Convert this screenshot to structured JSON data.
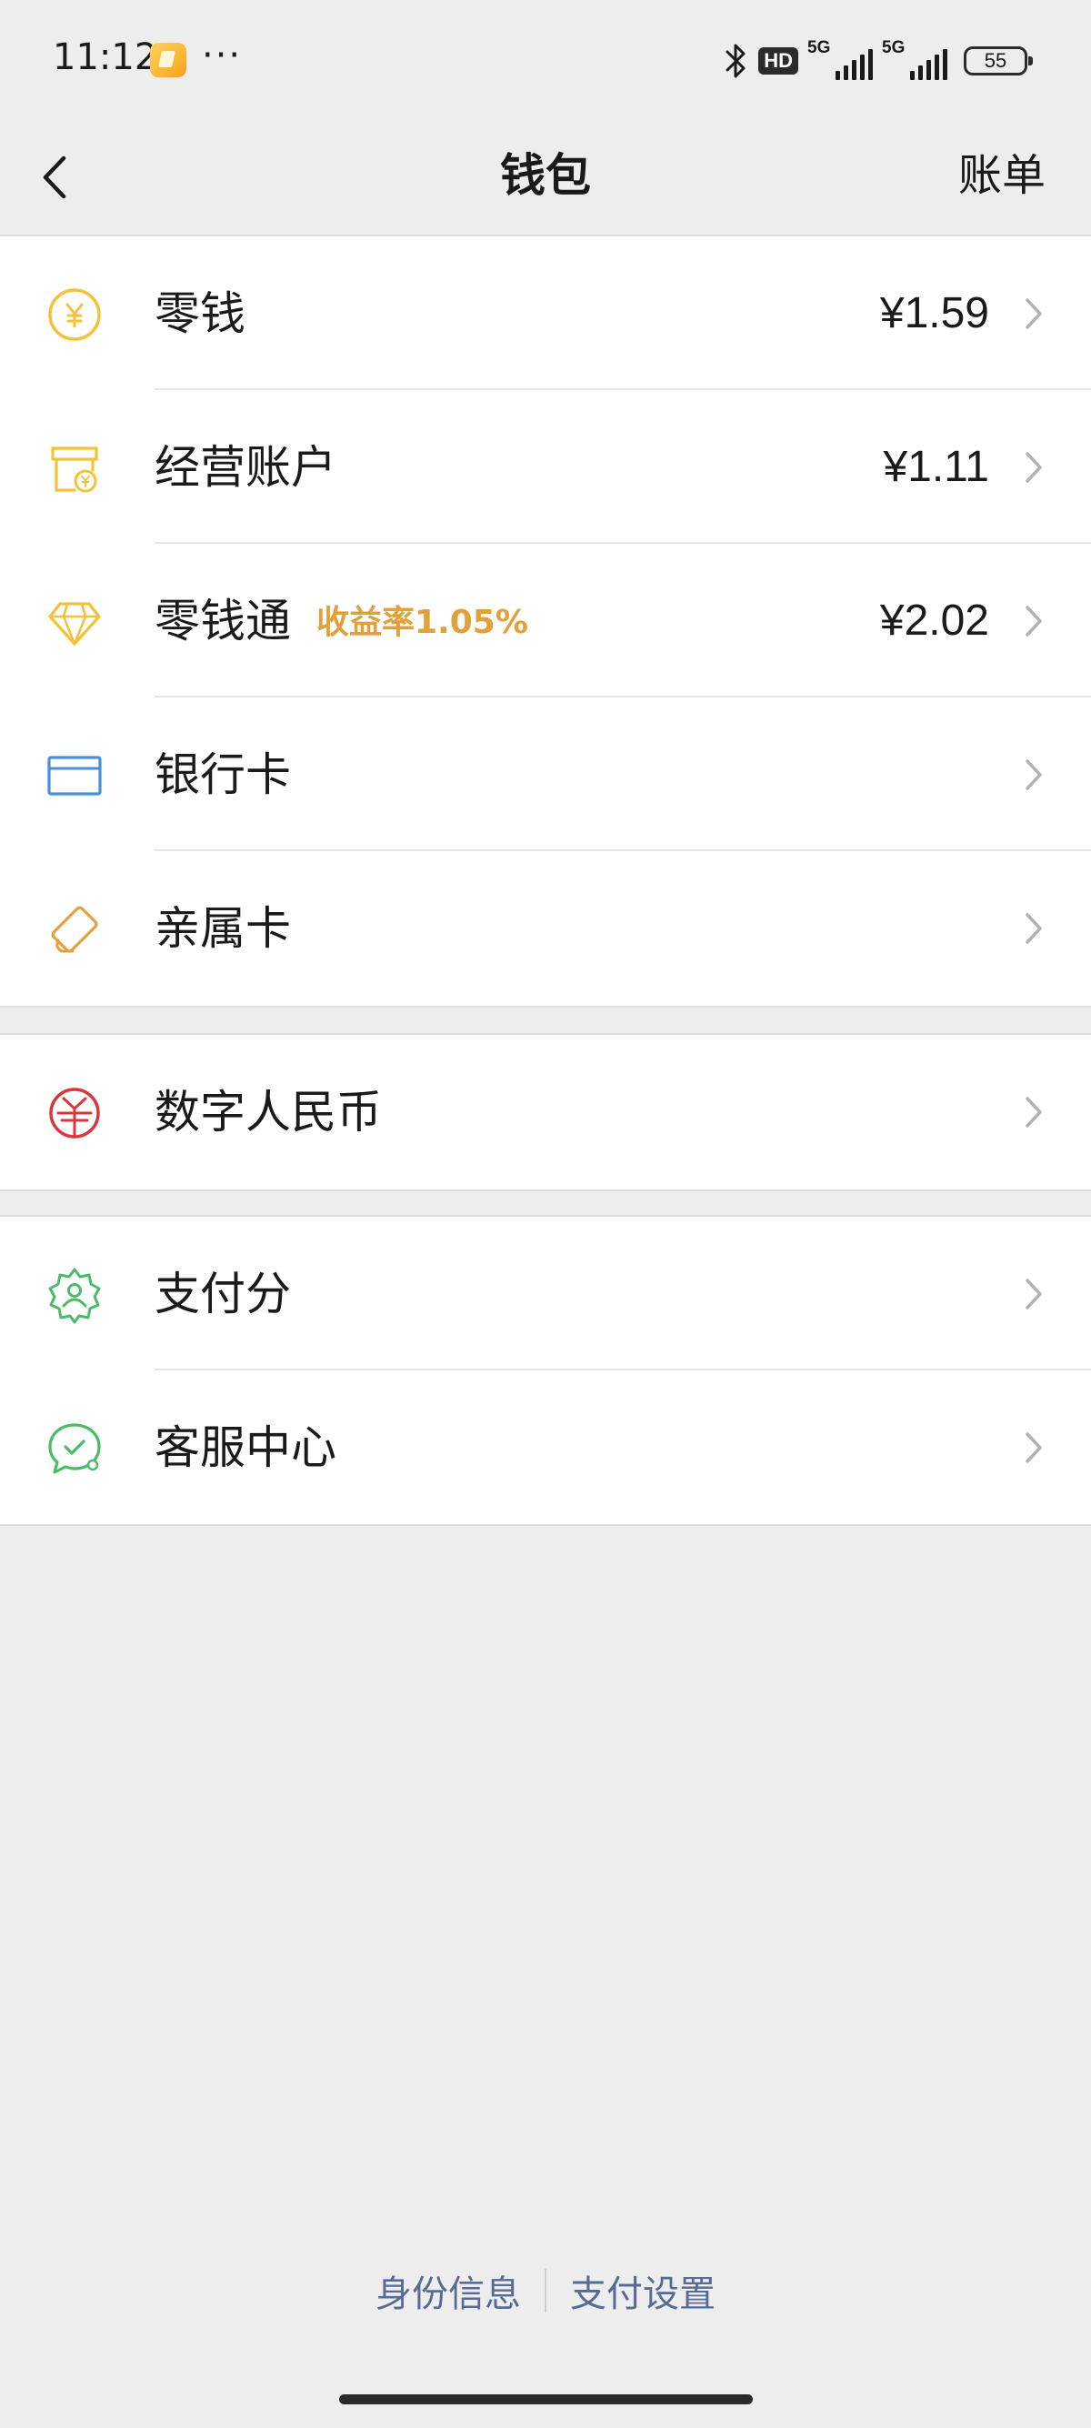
{
  "status_bar": {
    "time": "11:12",
    "dots": "···",
    "hd_badge": "HD",
    "sim1_label": "5G",
    "sim2_label": "5G",
    "battery": "55"
  },
  "nav": {
    "title": "钱包",
    "bill_label": "账单"
  },
  "groups": [
    {
      "items": [
        {
          "label": "零钱",
          "value": "¥1.59",
          "icon": "yuan-coin-icon",
          "icon_color": "#f5c136"
        },
        {
          "label": "经营账户",
          "value": "¥1.11",
          "icon": "business-shop-icon",
          "icon_color": "#f5c136"
        },
        {
          "label": "零钱通",
          "tag": "收益率1.05%",
          "value": "¥2.02",
          "icon": "diamond-icon",
          "icon_color": "#f5c136"
        },
        {
          "label": "银行卡",
          "icon": "bank-card-icon",
          "icon_color": "#4a90d9"
        },
        {
          "label": "亲属卡",
          "icon": "family-card-icon",
          "icon_color": "#e8a03c"
        }
      ]
    },
    {
      "items": [
        {
          "label": "数字人民币",
          "icon": "digital-rmb-icon",
          "icon_color": "#d9363e"
        }
      ]
    },
    {
      "items": [
        {
          "label": "支付分",
          "icon": "pay-score-icon",
          "icon_color": "#4cbb68"
        },
        {
          "label": "客服中心",
          "icon": "customer-service-icon",
          "icon_color": "#4cbb68"
        }
      ]
    }
  ],
  "footer": {
    "identity_label": "身份信息",
    "settings_label": "支付设置",
    "link_color": "#576b95"
  },
  "colors": {
    "background": "#ededed",
    "tag": "#e0a13a"
  }
}
